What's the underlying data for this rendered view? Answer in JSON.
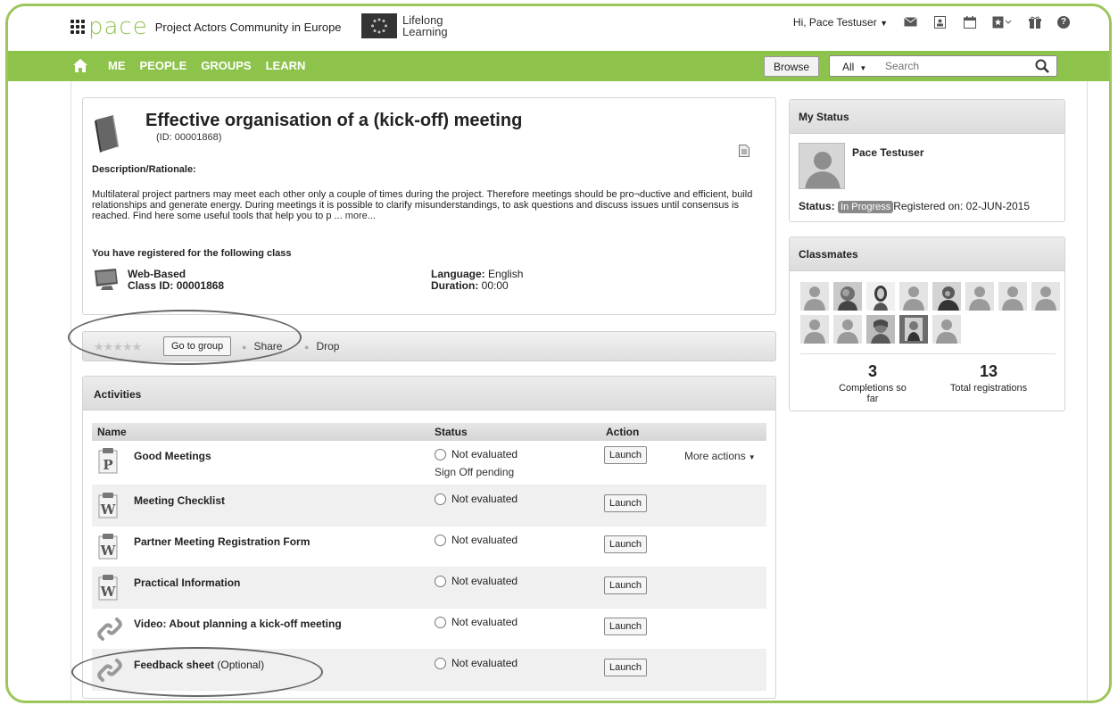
{
  "header": {
    "brand_name": "pace",
    "tagline": "Project Actors Community in Europe",
    "lifelong_line1": "Lifelong",
    "lifelong_line2": "Learning",
    "greeting": "Hi, Pace Testuser",
    "icons": [
      "mail-icon",
      "contact-card-icon",
      "calendar-icon",
      "bookmark-icon",
      "gift-icon",
      "help-icon"
    ]
  },
  "nav": {
    "items": [
      "ME",
      "PEOPLE",
      "GROUPS",
      "LEARN"
    ],
    "browse_label": "Browse",
    "search_scope": "All",
    "search_placeholder": "Search"
  },
  "course": {
    "title": "Effective organisation of a (kick-off) meeting",
    "id_text": "(ID: 00001868)",
    "description_heading": "Description/Rationale:",
    "description": "Multilateral project partners may meet each other only a couple of times during the project. Therefore meetings should be pro¬ductive and efficient, build relationships and generate energy. During meetings it is possible to clarify misunderstandings, to ask questions and discuss issues until consensus is reached. Find here some useful tools that help you to p ...",
    "more_link": "more...",
    "registered_heading": "You have registered for the following class",
    "class_type": "Web-Based",
    "class_id_label": "Class ID:",
    "class_id": "00001868",
    "language_label": "Language:",
    "language": "English",
    "duration_label": "Duration:",
    "duration": "00:00"
  },
  "actions": {
    "rating_stars": 5,
    "go_to_group": "Go to group",
    "share": "Share",
    "drop": "Drop"
  },
  "activities": {
    "title": "Activities",
    "columns": [
      "Name",
      "Status",
      "Action"
    ],
    "rows": [
      {
        "type": "P",
        "name": "Good Meetings",
        "optional": "",
        "status": "Not evaluated",
        "sub_status": "Sign Off pending",
        "action": "Launch",
        "more": "More actions"
      },
      {
        "type": "W",
        "name": "Meeting Checklist",
        "optional": "",
        "status": "Not evaluated",
        "sub_status": "",
        "action": "Launch",
        "more": ""
      },
      {
        "type": "W",
        "name": "Partner Meeting Registration Form",
        "optional": "",
        "status": "Not evaluated",
        "sub_status": "",
        "action": "Launch",
        "more": ""
      },
      {
        "type": "W",
        "name": "Practical Information",
        "optional": "",
        "status": "Not evaluated",
        "sub_status": "",
        "action": "Launch",
        "more": ""
      },
      {
        "type": "link",
        "name": "Video: About planning a kick-off meeting",
        "optional": "",
        "status": "Not evaluated",
        "sub_status": "",
        "action": "Launch",
        "more": ""
      },
      {
        "type": "link",
        "name": "Feedback sheet",
        "optional": "(Optional)",
        "status": "Not evaluated",
        "sub_status": "",
        "action": "Launch",
        "more": ""
      }
    ]
  },
  "my_status": {
    "title": "My Status",
    "user": "Pace Testuser",
    "status_label": "Status:",
    "status": "In Progress",
    "registered_on": "Registered on: 02-JUN-2015"
  },
  "classmates": {
    "title": "Classmates",
    "count_shown": 13,
    "completions": "3",
    "completions_label": "Completions so far",
    "total": "13",
    "total_label": "Total registrations"
  }
}
